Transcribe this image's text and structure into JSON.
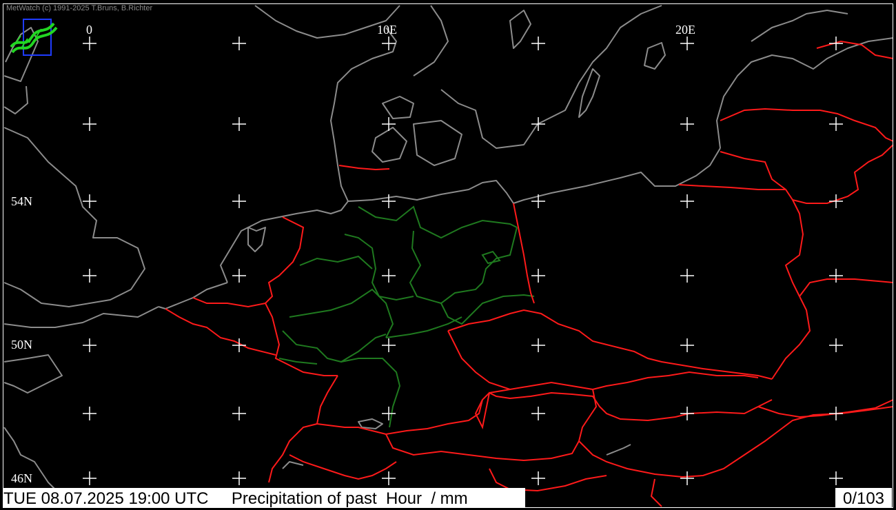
{
  "copyright": "MetWatch  (c) 1991-2025 T.Bruns, B.Richter",
  "status": {
    "datetime": "TUE 08.07.2025 19:00 UTC",
    "product": "Precipitation of past  Hour  / mm",
    "count": "0/103"
  },
  "graticule": {
    "longitude_labels": [
      "0",
      "10E",
      "20E"
    ],
    "latitude_labels": [
      "54N",
      "50N",
      "46N"
    ]
  },
  "colors": {
    "background": "#000000",
    "coastline": "#8c8c8c",
    "country_border": "#ff1a1a",
    "state_border": "#1f7a1f",
    "grid_cross": "#ffffff",
    "logo": "#22d622"
  },
  "icons": [
    "metwatch-logo-icon",
    "grid-cross-icon"
  ]
}
